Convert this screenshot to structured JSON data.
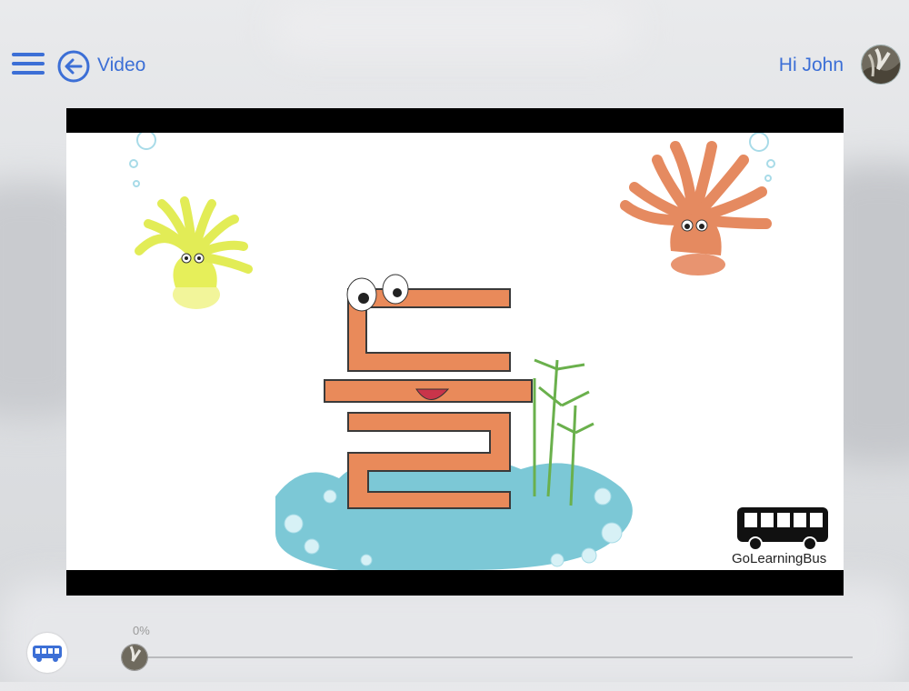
{
  "header": {
    "menu_icon": "hamburger-menu-icon",
    "back_icon": "arrow-left-circle-icon",
    "title": "Video",
    "greeting": "Hi John",
    "avatar_icon": "user-avatar"
  },
  "video": {
    "brand_name": "GoLearningBus",
    "letter_characters": "ㄷ ㄹ",
    "colors": {
      "accent": "#3c6fd6",
      "letter": "#e98a5a",
      "coral_yellow": "#e6ef5a",
      "coral_orange": "#e58a60",
      "water": "#7cc8d6"
    }
  },
  "footer": {
    "logo_icon": "bus-logo-icon",
    "progress_text": "0%",
    "progress_value": 0
  }
}
